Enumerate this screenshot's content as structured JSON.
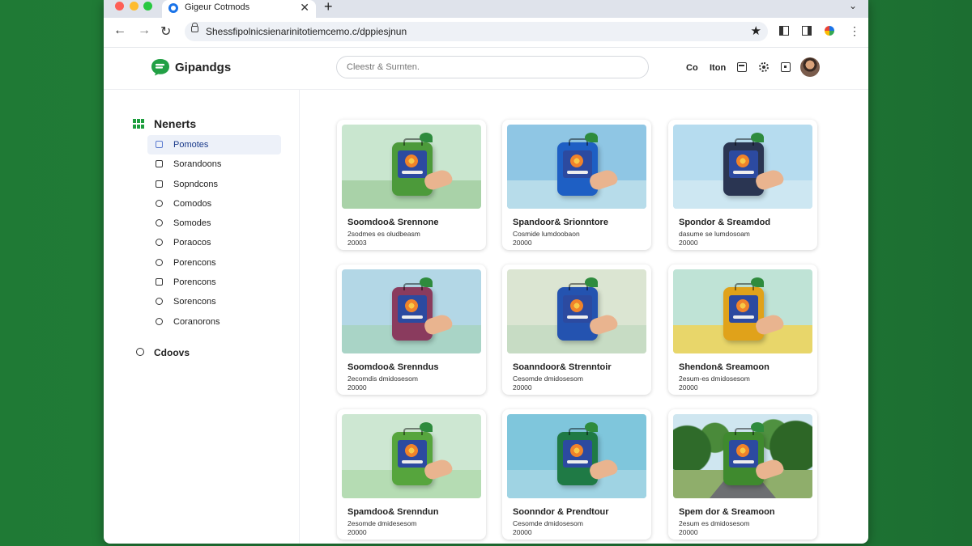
{
  "browser": {
    "tab_title": "Gigeur Cotmods",
    "tab_close": "✕",
    "new_tab": "+",
    "tab_menu": "⌄",
    "back": "←",
    "forward": "→",
    "reload": "↻",
    "url": "Shessfipolnicsienarinitotiemcemo.c/dppiesjnun",
    "star": "★",
    "menu": "⋮"
  },
  "header": {
    "brand": "Gipandgs",
    "search_placeholder": "Cleestr & Surnten.",
    "link1": "Co",
    "link2": "Iton"
  },
  "sidebar": {
    "heading": "Nenerts",
    "items": [
      {
        "label": "Pomotes",
        "active": true
      },
      {
        "label": "Sorandoons"
      },
      {
        "label": "Sopndcons"
      },
      {
        "label": "Comodos"
      },
      {
        "label": "Somodes"
      },
      {
        "label": "Poraocos"
      },
      {
        "label": "Porencons"
      },
      {
        "label": "Porencons"
      },
      {
        "label": "Sorencons"
      },
      {
        "label": "Coranorons"
      }
    ],
    "extra": "Cdoovs"
  },
  "cards": [
    {
      "title": "Soomdoo& Srennone",
      "subtitle": "2sodmes es oludbeasm",
      "number": "20003",
      "device_color": "#4c9a3a",
      "bg_top": "#c9e6cf",
      "bg_ground": "#a9d2a8"
    },
    {
      "title": "Spandoor& Srionntore",
      "subtitle": "Cosmide lumdoobaon",
      "number": "20000",
      "device_color": "#1e5fc4",
      "bg_top": "#8fc6e4",
      "bg_ground": "#b7dcea"
    },
    {
      "title": "Spondor & Sreamdod",
      "subtitle": "dasume se lumdosoam",
      "number": "20000",
      "device_color": "#2a3552",
      "bg_top": "#b6dcef",
      "bg_ground": "#cde7f2"
    },
    {
      "title": "Soomdoo& Srenndus",
      "subtitle": "2ecomdis dmidosesom",
      "number": "20000",
      "device_color": "#8a3b5e",
      "bg_top": "#b3d7e6",
      "bg_ground": "#a9d4c6"
    },
    {
      "title": "Soanndoor& Strenntoir",
      "subtitle": "Cesomde dmidosesom",
      "number": "20000",
      "device_color": "#2453b0",
      "bg_top": "#dbe5d2",
      "bg_ground": "#c7dcc4"
    },
    {
      "title": "Shendon& Sreamoon",
      "subtitle": "2esum-es dmidosesom",
      "number": "20000",
      "device_color": "#e0a21a",
      "bg_top": "#bfe3d6",
      "bg_ground": "#e8d66a"
    },
    {
      "title": "Spamdoo& Srenndun",
      "subtitle": "2esomde dmidesesom",
      "number": "20000",
      "device_color": "#56a53d",
      "bg_top": "#cde7d2",
      "bg_ground": "#b5dcb3"
    },
    {
      "title": "Soonndor & Prendtour",
      "subtitle": "Cesomde dmidosesom",
      "number": "20000",
      "device_color": "#1f7a45",
      "bg_top": "#7fc6dc",
      "bg_ground": "#9fd3e3"
    },
    {
      "title": "Spem dor & Sreamoon",
      "subtitle": "2esum es dmidosesom",
      "number": "20000",
      "device_color": "#3f8a2e",
      "bg_top": "#cfe6f0",
      "bg_ground": "#8fae6b",
      "scene": "road"
    }
  ]
}
